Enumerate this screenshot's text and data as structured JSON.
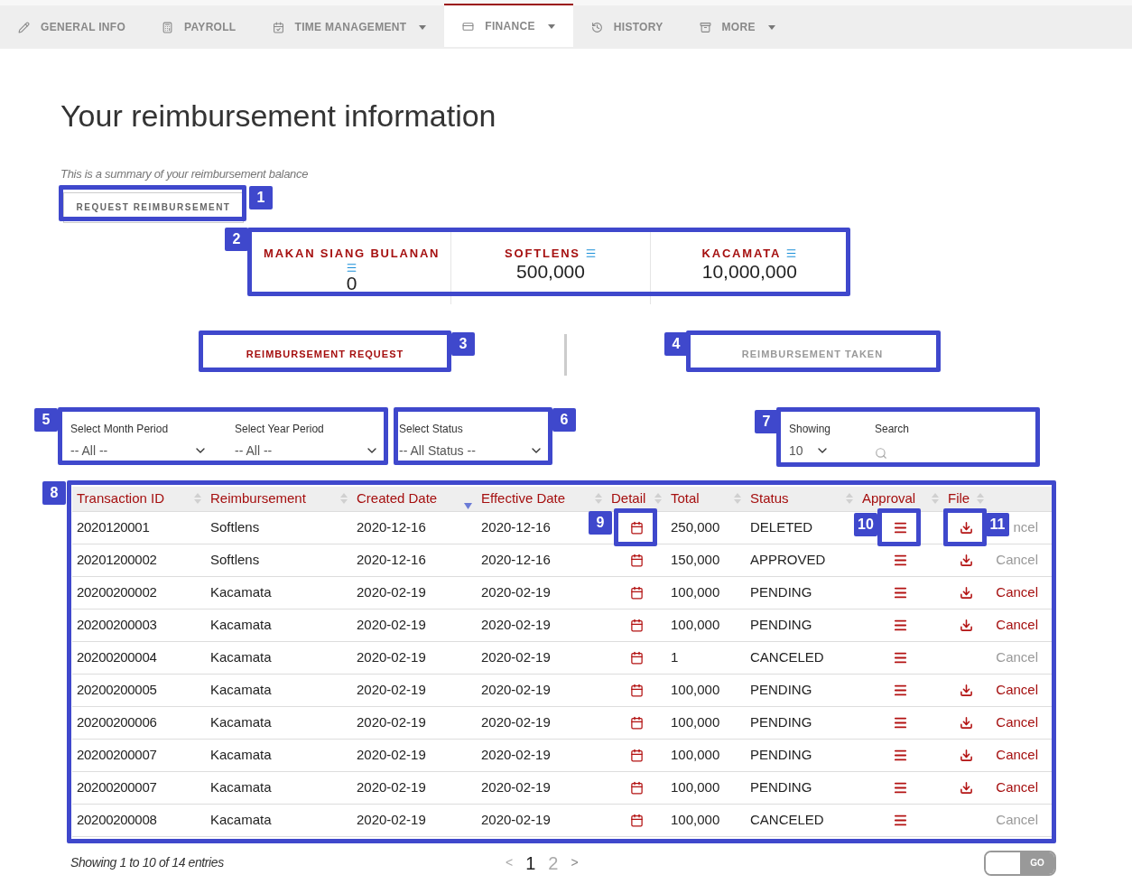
{
  "nav": {
    "tabs": [
      {
        "label": "GENERAL INFO",
        "dropdown": false,
        "selected": false
      },
      {
        "label": "PAYROLL",
        "dropdown": false,
        "selected": false
      },
      {
        "label": "TIME MANAGEMENT",
        "dropdown": true,
        "selected": false
      },
      {
        "label": "FINANCE",
        "dropdown": true,
        "selected": true
      },
      {
        "label": "HISTORY",
        "dropdown": false,
        "selected": false
      },
      {
        "label": "MORE",
        "dropdown": true,
        "selected": false
      }
    ]
  },
  "title": "Your reimbursement information",
  "subtitle": "This is a summary of your reimbursement balance",
  "request_button": "REQUEST REIMBURSEMENT",
  "balances": [
    {
      "name": "MAKAN SIANG BULANAN",
      "amount": "0"
    },
    {
      "name": "SOFTLENS",
      "amount": "500,000"
    },
    {
      "name": "KACAMATA",
      "amount": "10,000,000"
    }
  ],
  "view_tabs": [
    {
      "label": "REIMBURSEMENT REQUEST",
      "selected": true
    },
    {
      "label": "REIMBURSEMENT TAKEN",
      "selected": false
    }
  ],
  "filters": {
    "month": {
      "label": "Select Month Period",
      "value": "-- All --"
    },
    "year": {
      "label": "Select Year Period",
      "value": "-- All --"
    },
    "status": {
      "label": "Select Status",
      "value": "-- All Status --"
    },
    "showing": {
      "label": "Showing",
      "value": "10"
    },
    "search": {
      "label": "Search"
    }
  },
  "table": {
    "columns": [
      {
        "label": "Transaction ID",
        "sorted": false
      },
      {
        "label": "Reimbursement",
        "sorted": false
      },
      {
        "label": "Created Date",
        "sorted": true
      },
      {
        "label": "Effective Date",
        "sorted": false
      },
      {
        "label": "Detail",
        "sorted": false
      },
      {
        "label": "Total",
        "sorted": false
      },
      {
        "label": "Status",
        "sorted": false
      },
      {
        "label": "Approval",
        "sorted": false
      },
      {
        "label": "File",
        "sorted": false
      }
    ],
    "rows": [
      {
        "id": "2020120001",
        "reimbursement": "Softlens",
        "created": "2020-12-16",
        "effective": "2020-12-16",
        "total": "250,000",
        "status": "DELETED",
        "file": true,
        "cancel": "ncel",
        "cancel_enabled": false
      },
      {
        "id": "20201200002",
        "reimbursement": "Softlens",
        "created": "2020-12-16",
        "effective": "2020-12-16",
        "total": "150,000",
        "status": "APPROVED",
        "file": true,
        "cancel": "Cancel",
        "cancel_enabled": false
      },
      {
        "id": "20200200002",
        "reimbursement": "Kacamata",
        "created": "2020-02-19",
        "effective": "2020-02-19",
        "total": "100,000",
        "status": "PENDING",
        "file": true,
        "cancel": "Cancel",
        "cancel_enabled": true
      },
      {
        "id": "20200200003",
        "reimbursement": "Kacamata",
        "created": "2020-02-19",
        "effective": "2020-02-19",
        "total": "100,000",
        "status": "PENDING",
        "file": true,
        "cancel": "Cancel",
        "cancel_enabled": true
      },
      {
        "id": "20200200004",
        "reimbursement": "Kacamata",
        "created": "2020-02-19",
        "effective": "2020-02-19",
        "total": "1",
        "status": "CANCELED",
        "file": false,
        "cancel": "Cancel",
        "cancel_enabled": false
      },
      {
        "id": "20200200005",
        "reimbursement": "Kacamata",
        "created": "2020-02-19",
        "effective": "2020-02-19",
        "total": "100,000",
        "status": "PENDING",
        "file": true,
        "cancel": "Cancel",
        "cancel_enabled": true
      },
      {
        "id": "20200200006",
        "reimbursement": "Kacamata",
        "created": "2020-02-19",
        "effective": "2020-02-19",
        "total": "100,000",
        "status": "PENDING",
        "file": true,
        "cancel": "Cancel",
        "cancel_enabled": true
      },
      {
        "id": "20200200007",
        "reimbursement": "Kacamata",
        "created": "2020-02-19",
        "effective": "2020-02-19",
        "total": "100,000",
        "status": "PENDING",
        "file": true,
        "cancel": "Cancel",
        "cancel_enabled": true
      },
      {
        "id": "20200200007",
        "reimbursement": "Kacamata",
        "created": "2020-02-19",
        "effective": "2020-02-19",
        "total": "100,000",
        "status": "PENDING",
        "file": true,
        "cancel": "Cancel",
        "cancel_enabled": true
      },
      {
        "id": "20200200008",
        "reimbursement": "Kacamata",
        "created": "2020-02-19",
        "effective": "2020-02-19",
        "total": "100,000",
        "status": "CANCELED",
        "file": false,
        "cancel": "Cancel",
        "cancel_enabled": false
      }
    ]
  },
  "footer": {
    "summary": "Showing 1 to 10 of 14 entries",
    "prev": "<",
    "pages": [
      {
        "label": "1",
        "selected": true
      },
      {
        "label": "2",
        "selected": false
      }
    ],
    "next": ">",
    "go": "GO"
  },
  "annotations": [
    "1",
    "2",
    "3",
    "4",
    "5",
    "6",
    "7",
    "8",
    "9",
    "10",
    "11"
  ]
}
